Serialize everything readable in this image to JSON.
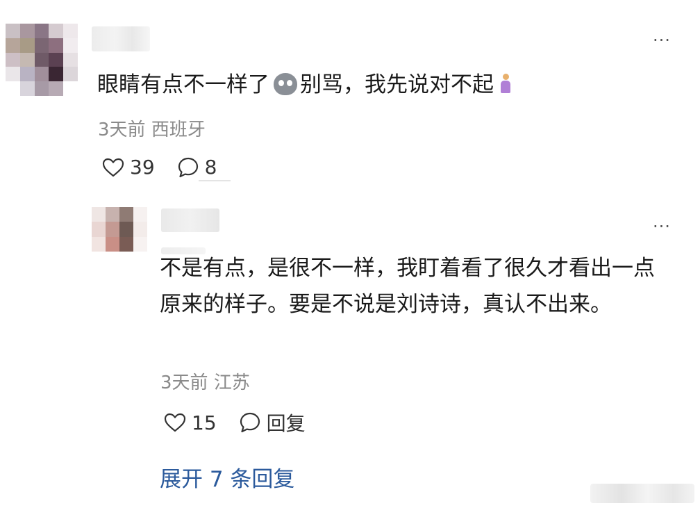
{
  "main_comment": {
    "text_before_emoji": "眼睛有点不一样了",
    "emoji_1": "face-emoji",
    "text_after_emoji": "别骂，我先说对不起",
    "emoji_2": "person-emoji",
    "time": "3天前",
    "location": "西班牙",
    "like_count": "39",
    "reply_count": "8",
    "more_label": "···"
  },
  "reply_comment": {
    "text": "不是有点，是很不一样，我盯着看了很久才看出一点原来的样子。要是不说是刘诗诗，真认不出来。",
    "time": "3天前",
    "location": "江苏",
    "like_count": "15",
    "reply_label": "回复",
    "more_label": "···"
  },
  "expand_replies": "展开 7 条回复",
  "avatar_main_colors": [
    "#c9c0c4",
    "#a9979f",
    "#8a7686",
    "#d5cbd0",
    "#eee8eb",
    "#b6a59a",
    "#a89b86",
    "#7b6673",
    "#8d6f7f",
    "#f1ecef",
    "#cdbfc5",
    "#c5b9b2",
    "#6f5a67",
    "#5b4152",
    "#e6e0e3",
    "#eae6e9",
    "#b9b3c3",
    "#a18f9b",
    "#3a2633",
    "#dcd6da",
    "#ffffff",
    "#d8d4dc",
    "#a79aa6",
    "#b7aab4",
    "#ffffff"
  ],
  "avatar_reply_colors": [
    "#efe6e4",
    "#c7b2ae",
    "#8f7b74",
    "#f6f1f0",
    "#e9d6d3",
    "#c49a93",
    "#6e5a54",
    "#f3ecea",
    "#f1e4e1",
    "#c98f86",
    "#7a5c55",
    "#f7f2f1"
  ],
  "colors": {
    "text": "#1a1a1a",
    "meta": "#8a8a8a",
    "link": "#2b5a9c"
  }
}
